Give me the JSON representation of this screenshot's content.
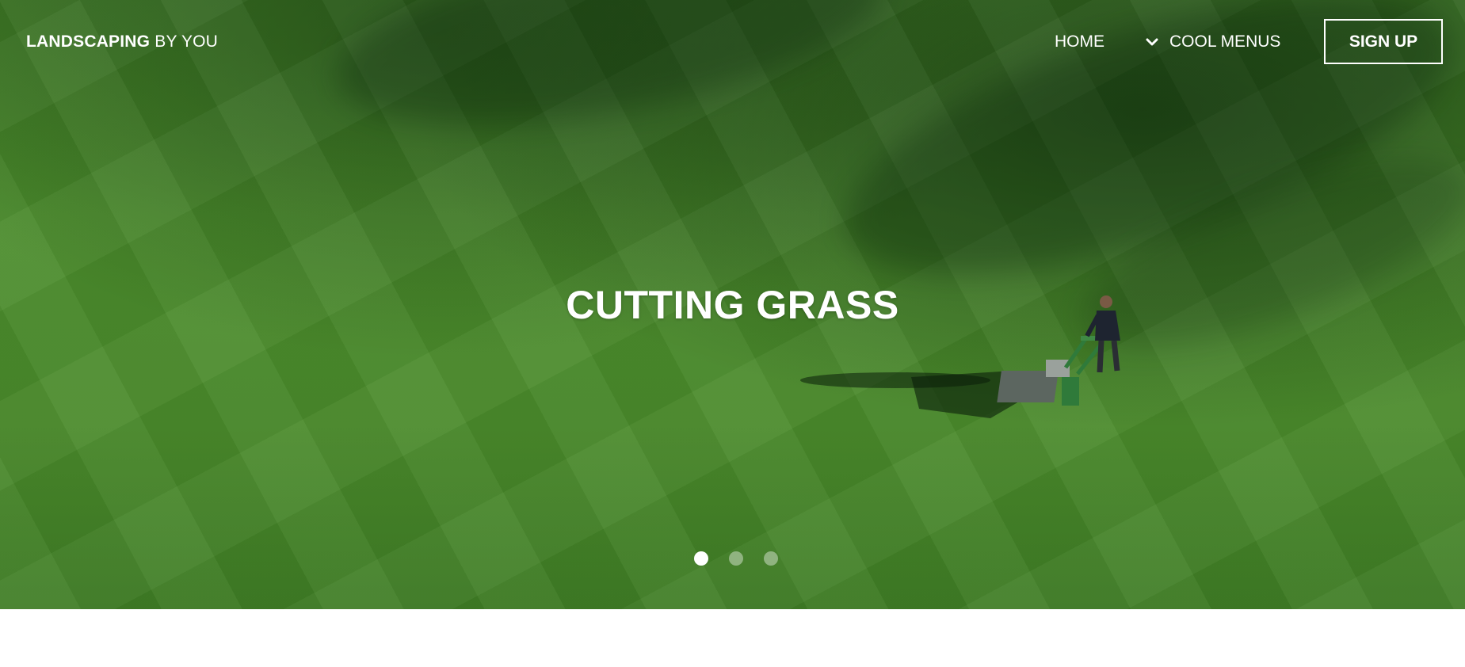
{
  "header": {
    "brand_strong": "LANDSCAPING",
    "brand_rest": " BY YOU",
    "nav": {
      "home_label": "HOME",
      "menus_label": "COOL MENUS",
      "menus_icon": "chevron-down-icon"
    },
    "signup_label": "SIGN UP"
  },
  "hero": {
    "title": "CUTTING GRASS",
    "background_color": "#4a8a2b",
    "slides_total": 3,
    "active_slide": 1
  },
  "colors": {
    "text": "#ffffff",
    "grass": "#4a8a2b",
    "page_bg": "#ffffff"
  }
}
